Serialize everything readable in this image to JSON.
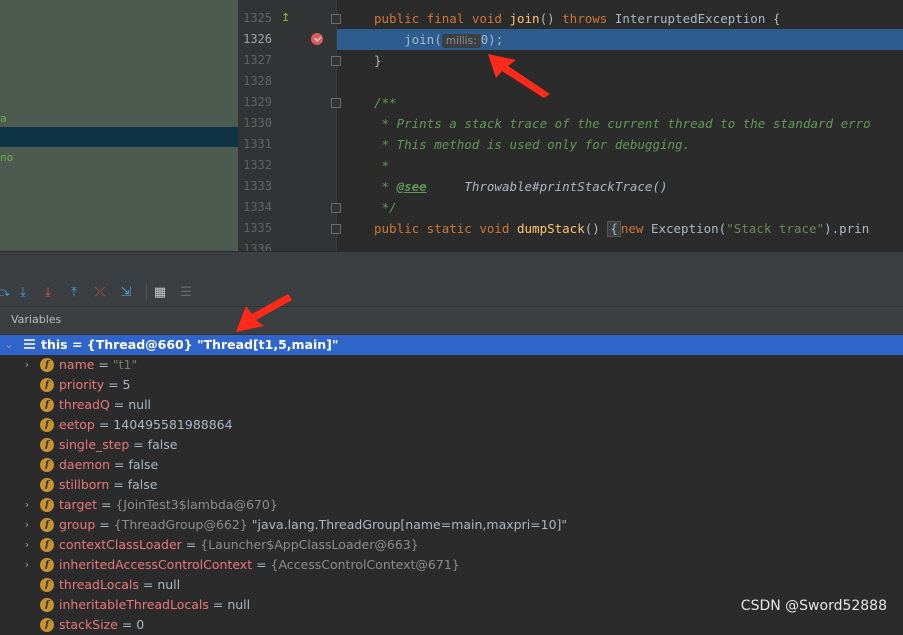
{
  "left_pane": {
    "fragments": [
      "a",
      "no"
    ]
  },
  "editor": {
    "lines": [
      {
        "num": "1325",
        "kind": "sig1"
      },
      {
        "num": "1326",
        "kind": "exec"
      },
      {
        "num": "1327",
        "kind": "close"
      },
      {
        "num": "1328",
        "kind": "blank"
      },
      {
        "num": "1329",
        "kind": "docopen"
      },
      {
        "num": "1330",
        "kind": "doc1"
      },
      {
        "num": "1331",
        "kind": "doc2"
      },
      {
        "num": "1332",
        "kind": "doc3"
      },
      {
        "num": "1333",
        "kind": "doc4"
      },
      {
        "num": "1334",
        "kind": "docclose"
      },
      {
        "num": "1335",
        "kind": "sig2"
      },
      {
        "num": "1336",
        "kind": "blank"
      }
    ],
    "code": {
      "sig1_kw": "public final void ",
      "sig1_fn": "join",
      "sig1_mid": "() ",
      "sig1_throws": "throws",
      "sig1_tail": " InterruptedException {",
      "exec_pre": "    join(",
      "exec_hint": "millis:",
      "exec_post": "0);",
      "close": "}",
      "docopen": "/**",
      "doc1": " * Prints a stack trace of the current thread to the standard erro",
      "doc2": " * This method is used only for debugging.",
      "doc3": " *",
      "doc4_pre": " * ",
      "doc4_tag": "@see",
      "doc4_ref": "     Throwable#printStackTrace()",
      "docclose": " */",
      "sig2_kw": "public static void ",
      "sig2_fn": "dumpStack",
      "sig2_mid": "() ",
      "sig2_fold": "{",
      "sig2_new": "new",
      "sig2_tail1": " Exception(",
      "sig2_str": "\"Stack trace\"",
      "sig2_tail2": ").prin"
    }
  },
  "toolbar": {
    "icons": [
      "step-over-icon",
      "step-into-icon",
      "force-step-into-icon",
      "step-out-icon",
      "drop-frame-icon",
      "run-to-cursor-icon",
      "evaluate-expression-icon",
      "trace-current-stream-icon"
    ]
  },
  "variables": {
    "panel_title": "Variables",
    "rows": [
      {
        "name": "this",
        "eq": " = ",
        "ref": "{Thread@660} ",
        "value": "\"Thread[t1,5,main]\"",
        "expandable": true,
        "expanded": true,
        "selected": true,
        "icon": "list"
      },
      {
        "name": "name",
        "eq": " = ",
        "value": "\"t1\"",
        "expandable": true,
        "string": true
      },
      {
        "name": "priority",
        "eq": " = ",
        "value": "5"
      },
      {
        "name": "threadQ",
        "eq": " = ",
        "value": "null"
      },
      {
        "name": "eetop",
        "eq": " = ",
        "value": "140495581988864"
      },
      {
        "name": "single_step",
        "eq": " = ",
        "value": "false"
      },
      {
        "name": "daemon",
        "eq": " = ",
        "value": "false"
      },
      {
        "name": "stillborn",
        "eq": " = ",
        "value": "false"
      },
      {
        "name": "target",
        "eq": " = ",
        "ref": "{JoinTest3$lambda@670}",
        "value": "",
        "expandable": true
      },
      {
        "name": "group",
        "eq": " = ",
        "ref": "{ThreadGroup@662} ",
        "value": "\"java.lang.ThreadGroup[name=main,maxpri=10]\"",
        "expandable": true
      },
      {
        "name": "contextClassLoader",
        "eq": " = ",
        "ref": "{Launcher$AppClassLoader@663}",
        "value": "",
        "expandable": true
      },
      {
        "name": "inheritedAccessControlContext",
        "eq": " = ",
        "ref": "{AccessControlContext@671}",
        "value": "",
        "expandable": true
      },
      {
        "name": "threadLocals",
        "eq": " = ",
        "value": "null"
      },
      {
        "name": "inheritableThreadLocals",
        "eq": " = ",
        "value": "null"
      },
      {
        "name": "stackSize",
        "eq": " = ",
        "value": "0"
      }
    ]
  },
  "watermark": "CSDN @Sword52888",
  "colors": {
    "annotation_arrow": "#ff2a1a",
    "selection": "#2f65ca",
    "exec_line": "#2d5c8f"
  }
}
